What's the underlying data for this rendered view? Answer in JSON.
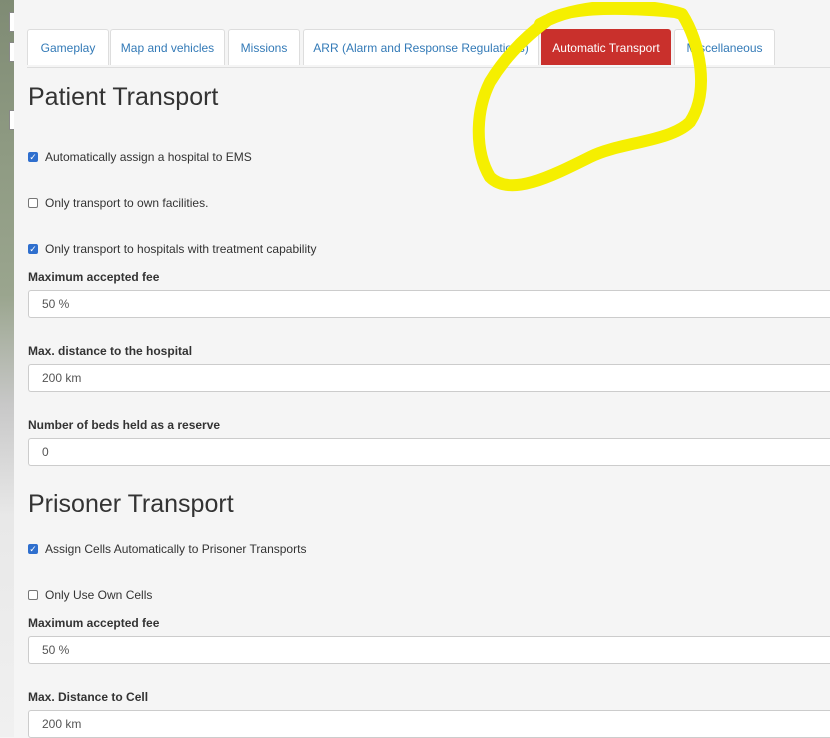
{
  "tabs": [
    {
      "label": "Gameplay",
      "active": false
    },
    {
      "label": "Map and vehicles",
      "active": false
    },
    {
      "label": "Missions",
      "active": false
    },
    {
      "label": "ARR (Alarm and Response Regulations)",
      "active": false
    },
    {
      "label": "Automatic Transport",
      "active": true
    },
    {
      "label": "Miscellaneous",
      "active": false
    }
  ],
  "patient": {
    "heading": "Patient Transport",
    "auto_assign": {
      "label": "Automatically assign a hospital to EMS",
      "checked": true
    },
    "own_facilities": {
      "label": "Only transport to own facilities.",
      "checked": false
    },
    "treatment_capability": {
      "label": "Only transport to hospitals with treatment capability",
      "checked": true
    },
    "max_fee": {
      "label": "Maximum accepted fee",
      "value": "50 %"
    },
    "max_distance": {
      "label": "Max. distance to the hospital",
      "value": "200 km"
    },
    "reserve_beds": {
      "label": "Number of beds held as a reserve",
      "value": "0"
    }
  },
  "prisoner": {
    "heading": "Prisoner Transport",
    "auto_cells": {
      "label": "Assign Cells Automatically to Prisoner Transports",
      "checked": true
    },
    "own_cells": {
      "label": "Only Use Own Cells",
      "checked": false
    },
    "max_fee": {
      "label": "Maximum accepted fee",
      "value": "50 %"
    },
    "max_distance": {
      "label": "Max. Distance to Cell",
      "value": "200 km"
    }
  },
  "colors": {
    "active_tab": "#c9302c",
    "link": "#337ab7",
    "highlight": "#f5ef00",
    "checkbox": "#2f6fce"
  }
}
